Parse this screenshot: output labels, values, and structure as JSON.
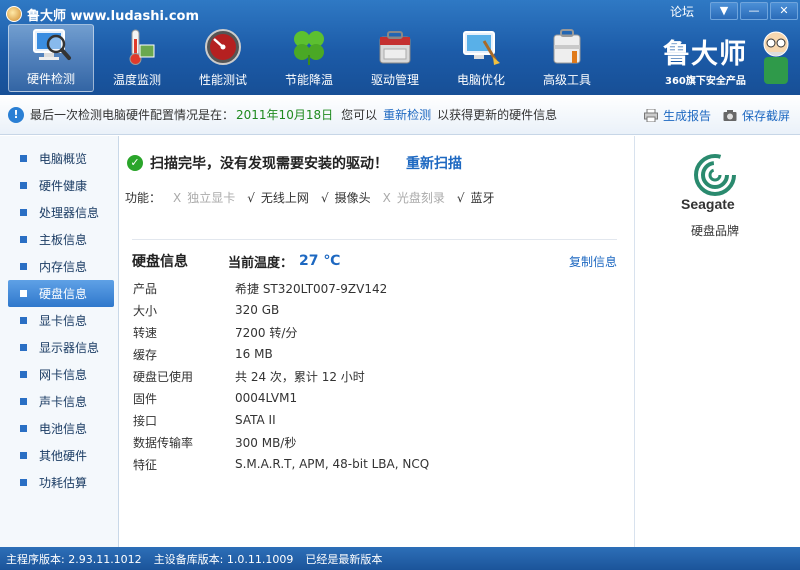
{
  "window": {
    "title": "鲁大师 www.ludashi.com",
    "forum": "论坛",
    "controls": [
      "▼",
      "—",
      "✕"
    ]
  },
  "nav": [
    {
      "label": "硬件检测",
      "icon": "monitor-magnifier-icon",
      "active": true
    },
    {
      "label": "温度监测",
      "icon": "thermometer-icon",
      "active": false
    },
    {
      "label": "性能测试",
      "icon": "speedometer-icon",
      "active": false
    },
    {
      "label": "节能降温",
      "icon": "clover-icon",
      "active": false
    },
    {
      "label": "驱动管理",
      "icon": "toolbox-icon",
      "active": false
    },
    {
      "label": "电脑优化",
      "icon": "monitor-broom-icon",
      "active": false
    },
    {
      "label": "高级工具",
      "icon": "tool-case-icon",
      "active": false
    }
  ],
  "brand": {
    "logo": "鲁大师",
    "sub": "360旗下安全产品"
  },
  "info_bar": {
    "prefix": "最后一次检测电脑硬件配置情况是在：",
    "date": "2011年10月18日",
    "middle": "您可以",
    "redetect": "重新检测",
    "suffix": "以获得更新的硬件信息",
    "report": "生成报告",
    "screenshot": "保存截屏"
  },
  "sidebar": {
    "items": [
      {
        "label": "电脑概览",
        "active": false
      },
      {
        "label": "硬件健康",
        "active": false
      },
      {
        "label": "处理器信息",
        "active": false
      },
      {
        "label": "主板信息",
        "active": false
      },
      {
        "label": "内存信息",
        "active": false
      },
      {
        "label": "硬盘信息",
        "active": true
      },
      {
        "label": "显卡信息",
        "active": false
      },
      {
        "label": "显示器信息",
        "active": false
      },
      {
        "label": "网卡信息",
        "active": false
      },
      {
        "label": "声卡信息",
        "active": false
      },
      {
        "label": "电池信息",
        "active": false
      },
      {
        "label": "其他硬件",
        "active": false
      },
      {
        "label": "功耗估算",
        "active": false
      }
    ]
  },
  "scan": {
    "message": "扫描完毕，没有发现需要安装的驱动！",
    "rescan": "重新扫描"
  },
  "features": {
    "label": "功能：",
    "items": [
      {
        "mark": "X",
        "label": "独立显卡",
        "available": false
      },
      {
        "mark": "√",
        "label": "无线上网",
        "available": true
      },
      {
        "mark": "√",
        "label": "摄像头",
        "available": true
      },
      {
        "mark": "X",
        "label": "光盘刻录",
        "available": false
      },
      {
        "mark": "√",
        "label": "蓝牙",
        "available": true
      }
    ]
  },
  "disk": {
    "heading": "硬盘信息",
    "temp_label": "当前温度：",
    "temp_value": "27 ℃",
    "copy": "复制信息",
    "specs": [
      {
        "k": "产品",
        "v": "希捷 ST320LT007-9ZV142"
      },
      {
        "k": "大小",
        "v": "320 GB"
      },
      {
        "k": "转速",
        "v": "7200 转/分"
      },
      {
        "k": "缓存",
        "v": "16 MB"
      },
      {
        "k": "硬盘已使用",
        "v": "共 24 次，累计 12 小时"
      },
      {
        "k": "固件",
        "v": "0004LVM1"
      },
      {
        "k": "接口",
        "v": "SATA II"
      },
      {
        "k": "数据传输率",
        "v": "300 MB/秒"
      },
      {
        "k": "特征",
        "v": "S.M.A.R.T,  APM,  48-bit LBA,  NCQ"
      }
    ]
  },
  "brand_panel": {
    "logo_text": "Seagate",
    "label": "硬盘品牌"
  },
  "status_bar": {
    "program_version": "主程序版本: 2.93.11.1012",
    "db_version": "主设备库版本: 1.0.11.1009",
    "latest": "已经是最新版本"
  },
  "colors": {
    "header": "#1c5ba8",
    "accent": "#1d68c1",
    "date": "#1f8a1f",
    "success": "#2aa52a"
  }
}
